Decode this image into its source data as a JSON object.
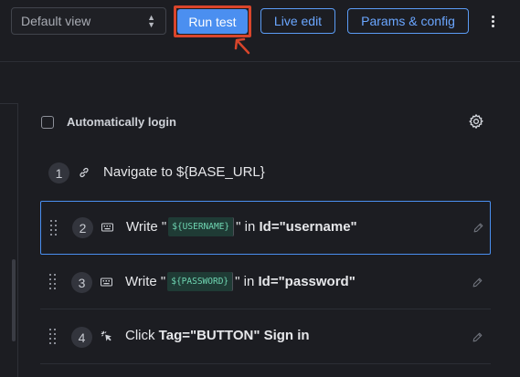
{
  "toolbar": {
    "view_select": "Default view",
    "run_test": "Run test",
    "live_edit": "Live edit",
    "params_config": "Params & config"
  },
  "settings": {
    "auto_login_label": "Automatically login",
    "auto_login_checked": false
  },
  "steps": [
    {
      "number": "1",
      "icon": "link-icon",
      "text": "Navigate to ${BASE_URL}"
    },
    {
      "number": "2",
      "icon": "keyboard-icon",
      "prefix": "Write \"",
      "variable": "${USERNAME}",
      "suffix": "\" in",
      "target": "Id=\"username\"",
      "selected": true
    },
    {
      "number": "3",
      "icon": "keyboard-icon",
      "prefix": "Write \"",
      "variable": "${PASSWORD}",
      "suffix": "\" in",
      "target": "Id=\"password\""
    },
    {
      "number": "4",
      "icon": "click-icon",
      "prefix": "Click",
      "target": "Tag=\"BUTTON\" Sign in"
    }
  ],
  "colors": {
    "accent": "#4b8ff0",
    "highlight_box": "#d9452b",
    "variable_chip_bg": "#1f3b35",
    "variable_chip_text": "#6fd6b2"
  }
}
